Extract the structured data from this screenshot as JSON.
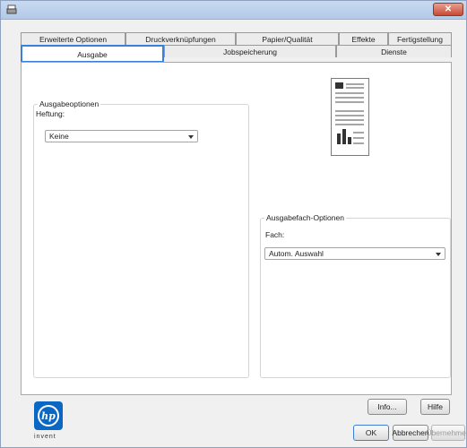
{
  "tabs_row1": [
    {
      "label": "Erweiterte Optionen"
    },
    {
      "label": "Druckverknüpfungen"
    },
    {
      "label": "Papier/Qualität"
    },
    {
      "label": "Effekte"
    },
    {
      "label": "Fertigstellung"
    }
  ],
  "tabs_row2": [
    {
      "label": "Ausgabe"
    },
    {
      "label": "Jobspeicherung"
    },
    {
      "label": "Dienste"
    }
  ],
  "output_options": {
    "group_label": "Ausgabeoptionen",
    "binding_label": "Heftung:",
    "binding_value": "Keine"
  },
  "output_bin": {
    "group_label": "Ausgabefach-Optionen",
    "tray_label": "Fach:",
    "tray_value": "Autom. Auswahl"
  },
  "buttons": {
    "info": "Info...",
    "help": "Hilfe",
    "ok": "OK",
    "cancel": "Abbrechen",
    "apply": "Übernehmen"
  },
  "logo": {
    "text": "hp",
    "tagline": "invent"
  },
  "colors": {
    "accent": "#3c7fd6",
    "hp_blue": "#0a68c4",
    "close": "#c74a33"
  },
  "icons": {
    "title": "printer-icon",
    "close": "close-icon",
    "preview": "page-preview-icon"
  }
}
